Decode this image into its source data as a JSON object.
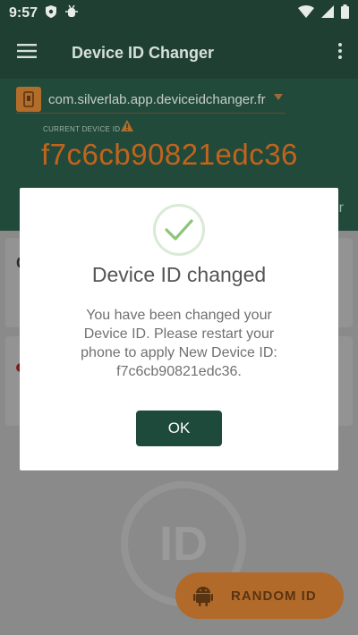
{
  "status_bar": {
    "time": "9:57"
  },
  "app_bar": {
    "title": "Device ID Changer"
  },
  "header": {
    "package_name": "com.silverlab.app.deviceidchanger.fr",
    "current_label": "CURRENT DEVICE ID",
    "current_id": "f7c6cb90821edc36",
    "partial_right_text": "r"
  },
  "cards": [
    {
      "leading_text": "C"
    },
    {
      "leading_text": ""
    }
  ],
  "watermark_text": "ID",
  "fab": {
    "label": "RANDOM ID",
    "icon": "android-icon"
  },
  "dialog": {
    "icon": "check-icon",
    "title": "Device ID changed",
    "message": "You have been changed your Device ID. Please restart your phone to apply New Device ID: f7c6cb90821edc36.",
    "ok_label": "OK"
  },
  "colors": {
    "primary_dark": "#1f3f33",
    "accent": "#c1641d",
    "button": "#1d4a3a",
    "check": "#8cc57a"
  }
}
